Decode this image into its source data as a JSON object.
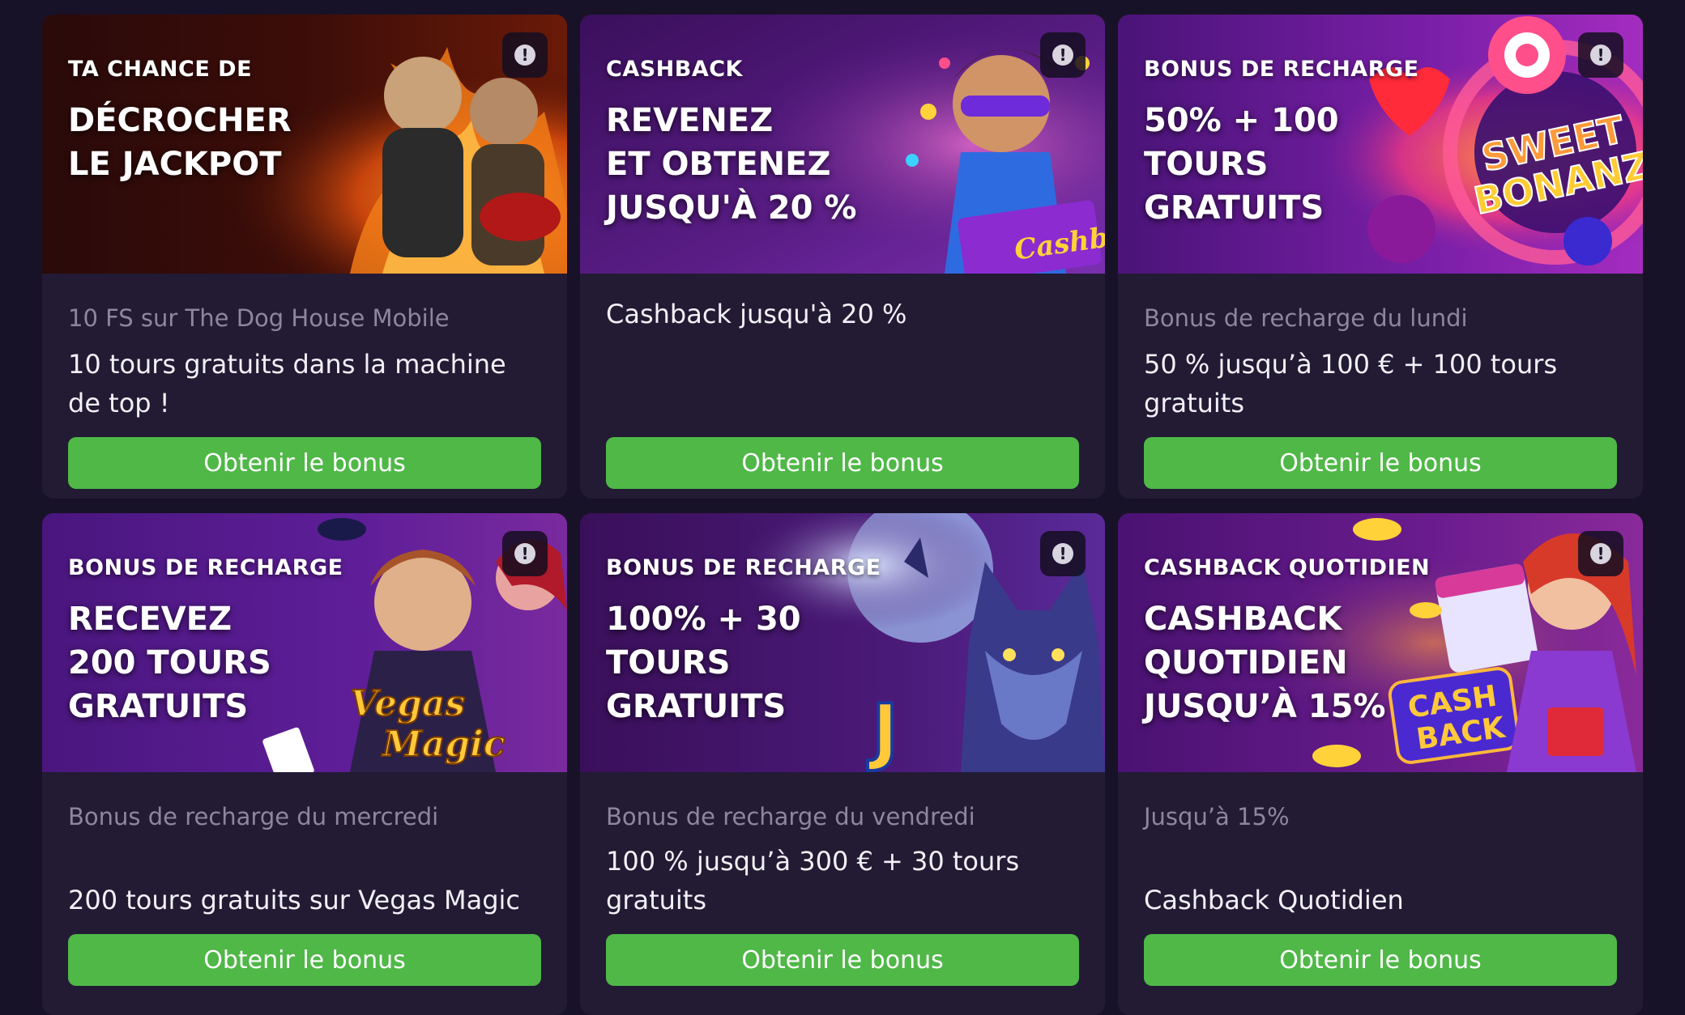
{
  "colors": {
    "page_bg": "#181228",
    "card_bg": "#221b33",
    "button_green": "#4fb847",
    "subtitle_gray": "#8d86a0"
  },
  "cards": [
    {
      "eyebrow": "TA CHANCE DE",
      "headline": "DÉCROCHER\nLE JACKPOT",
      "subtitle": "10 FS sur The Dog House Mobile",
      "description": "10 tours gratuits dans la machine de top !",
      "button": "Obtenir le bonus",
      "info_icon": "info-icon"
    },
    {
      "eyebrow": "CASHBACK",
      "headline": "REVENEZ\nET OBTENEZ\nJUSQU'À 20 %",
      "subtitle": "",
      "description": "Cashback jusqu'à 20 %",
      "button": "Obtenir le bonus",
      "info_icon": "info-icon",
      "art_text": "Cashback"
    },
    {
      "eyebrow": "BONUS DE RECHARGE",
      "headline": "50% + 100\nTOURS\nGRATUITS",
      "subtitle": "Bonus de recharge du lundi",
      "description": "50 % jusqu’à 100 € + 100 tours gratuits",
      "button": "Obtenir le bonus",
      "info_icon": "info-icon",
      "art_text": "SWEET BONANZA"
    },
    {
      "eyebrow": "BONUS DE RECHARGE",
      "headline": "RECEVEZ\n200 TOURS\nGRATUITS",
      "subtitle": "Bonus de recharge du mercredi",
      "description": "200 tours gratuits sur Vegas Magic",
      "button": "Obtenir le bonus",
      "info_icon": "info-icon",
      "art_text": "Vegas Magic"
    },
    {
      "eyebrow": "BONUS DE RECHARGE",
      "headline": "100% + 30\nTOURS\nGRATUITS",
      "subtitle": "Bonus de recharge du vendredi",
      "description": "100 % jusqu’à 300 € + 30 tours gratuits",
      "button": "Obtenir le bonus",
      "info_icon": "info-icon",
      "art_text": "J"
    },
    {
      "eyebrow": "CASHBACK QUOTIDIEN",
      "headline": "CASHBACK\nQUOTIDIEN\nJUSQU’À 15%",
      "subtitle": "Jusqu’à 15%",
      "description": "Cashback Quotidien",
      "button": "Obtenir le bonus",
      "info_icon": "info-icon",
      "art_text": "CASH BACK"
    }
  ]
}
